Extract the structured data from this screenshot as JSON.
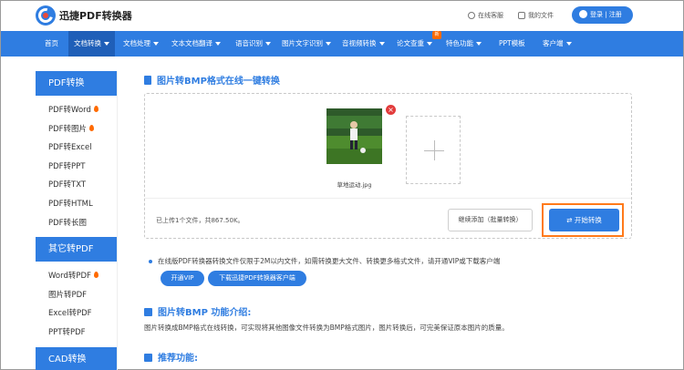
{
  "header": {
    "brand": "迅捷PDF转换器",
    "online_service": "在线客服",
    "my_files": "我的文件",
    "login": "登录 | 注册"
  },
  "nav": {
    "items": [
      {
        "label": "首页"
      },
      {
        "label": "文档转换"
      },
      {
        "label": "文档处理"
      },
      {
        "label": "文本文档翻译"
      },
      {
        "label": "语音识别"
      },
      {
        "label": "图片文字识别"
      },
      {
        "label": "音视频转换"
      },
      {
        "label": "论文查重"
      },
      {
        "label": "特色功能"
      },
      {
        "label": "PPT模板"
      },
      {
        "label": "客户端"
      }
    ],
    "new_badge": "新"
  },
  "sidebar": {
    "group1_title": "PDF转换",
    "group1_items": [
      "PDF转Word",
      "PDF转图片",
      "PDF转Excel",
      "PDF转PPT",
      "PDF转TXT",
      "PDF转HTML",
      "PDF转长图"
    ],
    "group2_title": "其它转PDF",
    "group2_items": [
      "Word转PDF",
      "图片转PDF",
      "Excel转PDF",
      "PPT转PDF"
    ],
    "group3_title": "CAD转换"
  },
  "main": {
    "title": "图片转BMP格式在线一键转换",
    "file_name": "草地运动.jpg",
    "status": "已上传1个文件，共867.50K。",
    "continue_button": "继续添加（批量转换）",
    "start_button": "开始转换",
    "notice": "在线版PDF转换器转换文件仅限于2M以内文件，如需转换更大文件、转换更多格式文件，请开通VIP或下载客户端",
    "vip_button": "开通VIP",
    "download_button": "下载迅捷PDF转换器客户端",
    "intro_title": "图片转BMP 功能介绍:",
    "intro_text": "图片转换成BMP格式在线转换，可实现将其他图像文件转换为BMP格式图片，图片转换后，可完美保证原本图片的质量。",
    "recommend_title": "推荐功能:"
  },
  "colors": {
    "accent": "#2f7de1",
    "nav_active": "#1f5fb8",
    "highlight": "#ff7a1a",
    "close": "#e23b3b"
  }
}
